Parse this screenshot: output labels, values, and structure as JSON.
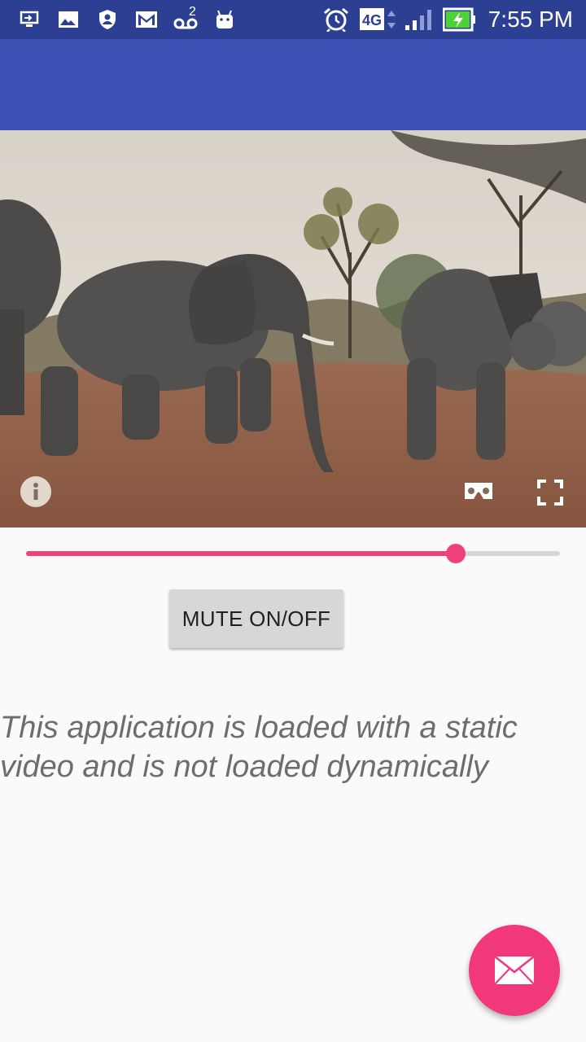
{
  "status_bar": {
    "time": "7:55 PM",
    "network": "4G",
    "voicemail_count": "2",
    "icons": [
      "screen-cast-icon",
      "gallery-icon",
      "account-shield-icon",
      "gmail-icon",
      "voicemail-icon",
      "android-icon",
      "alarm-icon",
      "network-4g-icon",
      "signal-icon",
      "battery-charging-icon"
    ]
  },
  "video": {
    "info_icon": "info-icon",
    "vr_icon": "cardboard-vr-icon",
    "fullscreen_icon": "fullscreen-icon"
  },
  "seekbar": {
    "progress": 0.805,
    "color": "#f0417a"
  },
  "mute_button": {
    "label": "MUTE ON/OFF"
  },
  "info_text": "This application is loaded with a static video and is not loaded dynamically",
  "fab": {
    "icon": "mail-icon",
    "color": "#f2387c"
  },
  "colors": {
    "status_bar": "#2c3f93",
    "app_bar": "#3b51b3"
  }
}
